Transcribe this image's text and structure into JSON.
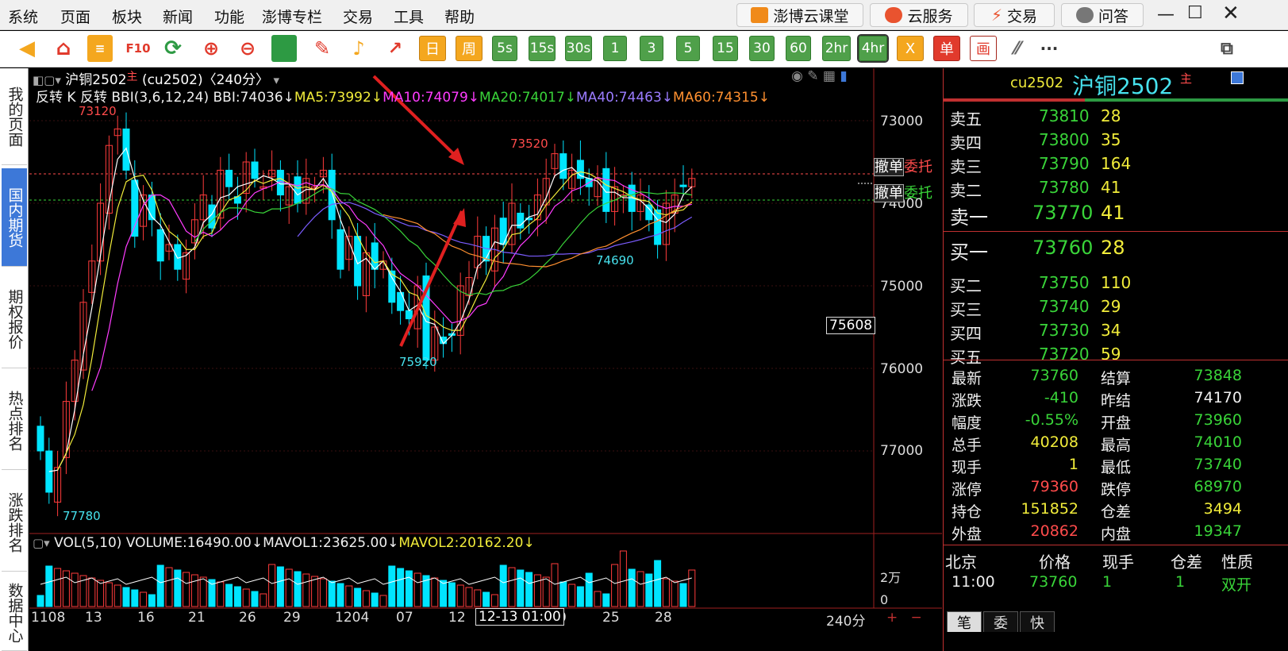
{
  "menu": [
    "系统",
    "页面",
    "板块",
    "新闻",
    "功能",
    "澎博专栏",
    "交易",
    "工具",
    "帮助"
  ],
  "header_buttons": {
    "course": "澎博云课堂",
    "cloud": "云服务",
    "trade": "交易",
    "qa": "问答"
  },
  "toolbar": {
    "f10": "F10",
    "periods": [
      "日",
      "周",
      "5s",
      "15s",
      "30s",
      "1",
      "3",
      "5",
      "15",
      "30",
      "60",
      "2hr",
      "4hr"
    ],
    "x": "X",
    "dan": "单",
    "hua": "画",
    "more": "···"
  },
  "sidebar": [
    "我的页面",
    "国内期货",
    "期权报价",
    "热点排名",
    "涨跌排名",
    "数据中心"
  ],
  "chart": {
    "title": "沪铜2502",
    "title_mark": "主",
    "code_period": "(cu2502)〈240分〉",
    "ind_prefix": "反转 K 反转",
    "bbi": "BBI(3,6,12,24) BBI:74036↓",
    "ma5": "MA5:73992↓",
    "ma10": "MA10:74079↓",
    "ma20": "MA20:74017↓",
    "ma40": "MA40:74463↓",
    "ma60": "MA60:74315↓",
    "price_ticks": [
      "73000",
      "74000",
      "75000",
      "76000",
      "77000"
    ],
    "cursor_price": "75608",
    "order_labels": {
      "cancel1": "撤单",
      "entrust1": "委托",
      "cancel2": "撤单",
      "entrust2": "委托"
    },
    "annotations": {
      "high": "73120",
      "high2": "73520",
      "low": "77780",
      "low2": "75920",
      "mid": "74690"
    },
    "vol_header": {
      "a": "VOL(5,10) VOLUME:16490.00↓",
      "b": "MAVOL1:23625.00↓",
      "c": "MAVOL2:20162.20↓"
    },
    "vol_ticks": [
      "2万",
      "0"
    ],
    "x_ticks": [
      "1108",
      "13",
      "16",
      "21",
      "26",
      "29",
      "1204",
      "07",
      "12",
      "0",
      "25",
      "28"
    ],
    "cursor_time": "12-13 01:00",
    "period_label": "240分",
    "colors": {
      "up": "#ff3b3b",
      "down": "#00e5ff",
      "ma5": "#ffffff",
      "bbi": "#f1ec3a",
      "ma10": "#ff3cff",
      "ma20": "#39d439",
      "ma40": "#7b5cff",
      "ma60": "#ff9030"
    }
  },
  "quote": {
    "code": "cu2502",
    "name": "沪铜2502",
    "mark": "主",
    "asks": [
      {
        "label": "卖五",
        "price": "73810",
        "vol": "28"
      },
      {
        "label": "卖四",
        "price": "73800",
        "vol": "35"
      },
      {
        "label": "卖三",
        "price": "73790",
        "vol": "164"
      },
      {
        "label": "卖二",
        "price": "73780",
        "vol": "41"
      },
      {
        "label": "卖一",
        "price": "73770",
        "vol": "41"
      }
    ],
    "bids": [
      {
        "label": "买一",
        "price": "73760",
        "vol": "28"
      },
      {
        "label": "买二",
        "price": "73750",
        "vol": "110"
      },
      {
        "label": "买三",
        "price": "73740",
        "vol": "29"
      },
      {
        "label": "买四",
        "price": "73730",
        "vol": "34"
      },
      {
        "label": "买五",
        "price": "73720",
        "vol": "59"
      }
    ],
    "stats": [
      {
        "l": "最新",
        "v": "73760",
        "r": "结算",
        "rv": "73848"
      },
      {
        "l": "涨跌",
        "v": "-410",
        "r": "昨结",
        "rv": "74170"
      },
      {
        "l": "幅度",
        "v": "-0.55%",
        "r": "开盘",
        "rv": "73960"
      },
      {
        "l": "总手",
        "v": "40208",
        "r": "最高",
        "rv": "74010"
      },
      {
        "l": "现手",
        "v": "1",
        "r": "最低",
        "rv": "73740"
      },
      {
        "l": "涨停",
        "v": "79360",
        "r": "跌停",
        "rv": "68970"
      },
      {
        "l": "持仓",
        "v": "151852",
        "r": "仓差",
        "rv": "3494"
      },
      {
        "l": "外盘",
        "v": "20862",
        "r": "内盘",
        "rv": "19347"
      }
    ],
    "trade_header": [
      "北京",
      "价格",
      "现手",
      "仓差",
      "性质"
    ],
    "trade_row": [
      "11:00",
      "73760",
      "1",
      "1",
      "双开"
    ],
    "bottom_tabs": [
      "笔",
      "委",
      "快"
    ]
  }
}
